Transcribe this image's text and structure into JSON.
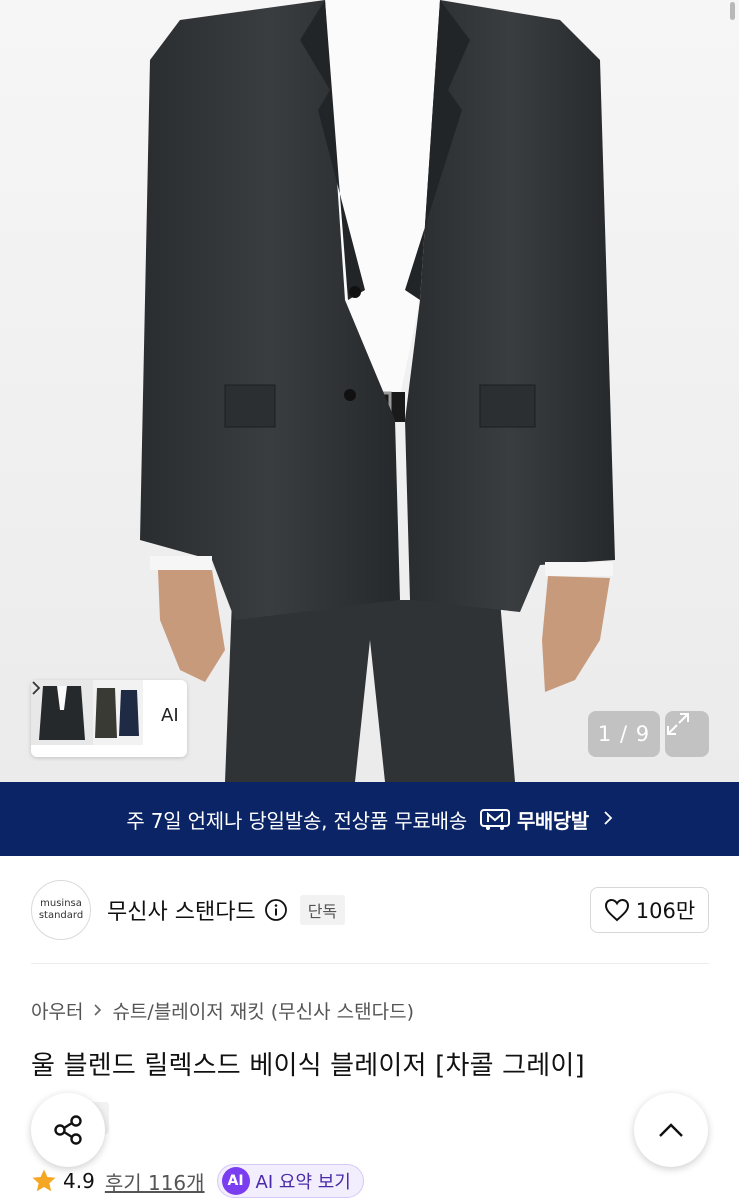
{
  "gallery": {
    "thumb_ai_label": "AI",
    "page_counter": "1 / 9"
  },
  "banner": {
    "text": "주 7일 언제나 당일발송, 전상품 무료배송",
    "badge": "무배당발"
  },
  "brand": {
    "logo_line1": "musinsa",
    "logo_line2": "standard",
    "name": "무신사 스탠다드",
    "tag": "단독",
    "likes": "106만"
  },
  "breadcrumb": {
    "level1": "아우터",
    "level2": "슈트/블레이저 재킷 (무신사 스탠다드)"
  },
  "product": {
    "title": "울 블렌드 릴렉스드 베이식 블레이저 [차콜 그레이]",
    "tag": "단독"
  },
  "rating": {
    "score": "4.9",
    "reviews": "후기 116개",
    "ai_badge": "AI",
    "ai_summary": "AI 요약 보기"
  },
  "colors": {
    "banner_bg": "#0b2466",
    "star": "#f5a623",
    "ai_purple": "#7a3df0"
  }
}
